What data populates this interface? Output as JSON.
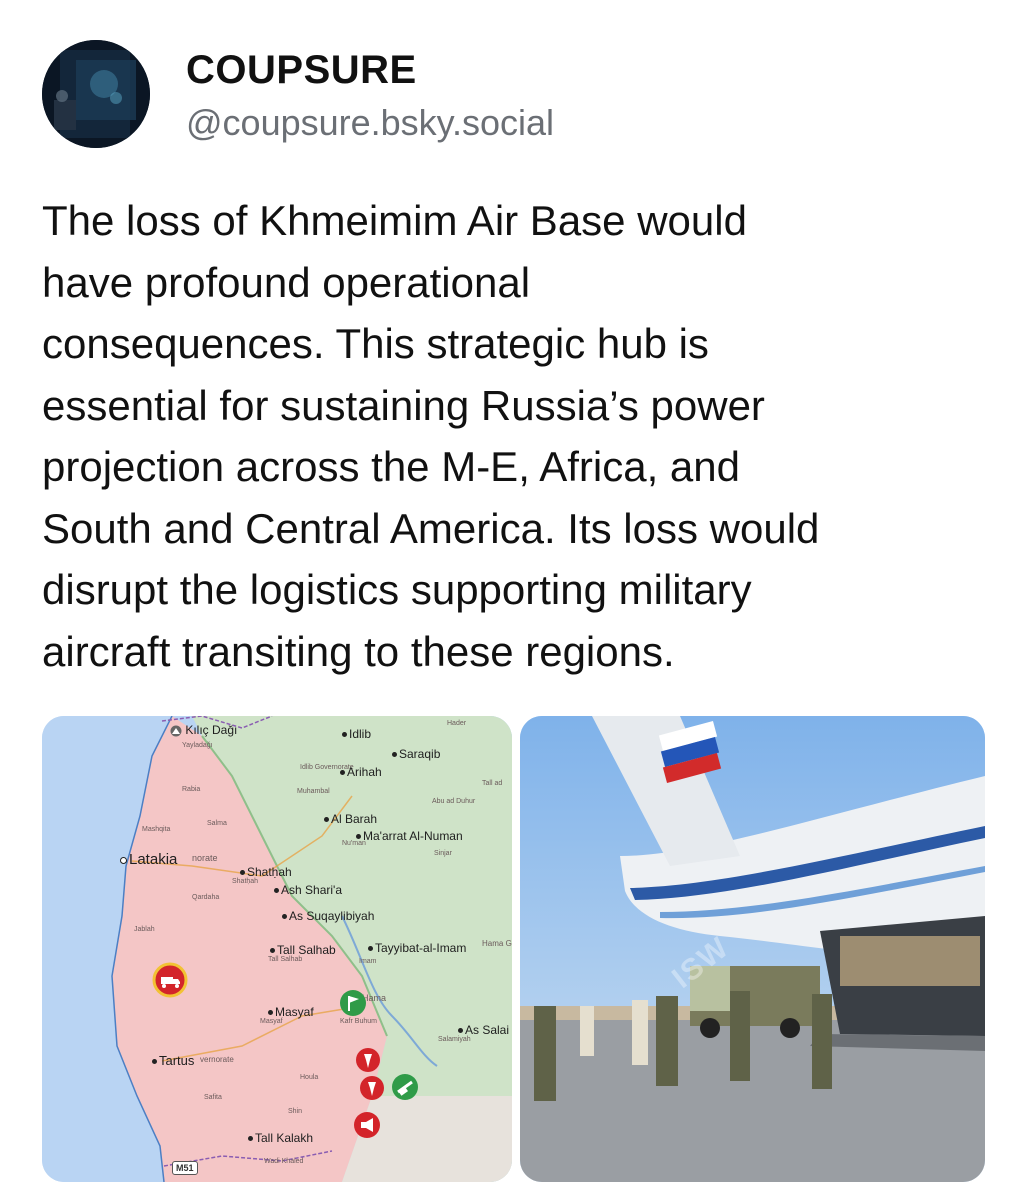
{
  "post": {
    "author_name": "COUPSURE",
    "author_handle": "@coupsure.bsky.social",
    "text": "The loss of Khmeimim Air Base would\nhave profound operational\nconsequences. This strategic hub is\nessential for sustaining Russia’s power\nprojection across the M-E, Africa, and\nSouth and Central America. Its loss would\ndisrupt the logistics supporting military\naircraft transiting to these regions."
  },
  "map": {
    "labels": {
      "kilic_dagi": "Kılıç Dağı",
      "yayladagi": "Yayladağı",
      "idlib": "Idlib",
      "idlib_gov": "Idlib Governorate",
      "saraqib": "Saraqib",
      "arihah": "Arihah",
      "rabia": "Rabia",
      "muhambal": "Muhambal",
      "hader": "Hader",
      "tall_ad": "Tall ad",
      "abu_ad_duhur": "Abu ad Duhur",
      "slinfah": "Salma",
      "mashqita": "Mashqita",
      "al_barah": "Al Barah",
      "maarrat": "Ma'arrat Al-Numan",
      "numan": "Nu'man",
      "sinjar": "Sinjar",
      "latakia": "Latakia",
      "latakia_gov": "norate",
      "qardaha": "Qardaha",
      "shathah": "Shatḥah",
      "shathah_small": "Shatḥah",
      "ash_sharia": "Ash Shari'a",
      "as_suqaylibiyah": "As Suqaylibiyah",
      "jablah": "Jablah",
      "tall_salhab": "Tall Salhab",
      "tall_salhab_small": "Tall Salhab",
      "tayyibat": "Tayyibat-al-Imam",
      "imam": "Imam",
      "hama_gov": "Hama G",
      "hama": "Hama",
      "masyaf": "Masyaf",
      "masyaf_small": "Masyaf",
      "kafr_buhum": "Kafr Buhum",
      "as_salamiyah": "As Salai",
      "salamiyah": "Salamiyah",
      "tartus": "Tartus",
      "tartus_gov": "vernorate",
      "houla": "Houla",
      "safita": "Safita",
      "shin": "Shin",
      "tall_kalakh": "Tall Kalakh",
      "wadi_khaled": "Wadi Khaled",
      "m51": "M51"
    }
  },
  "photo": {
    "watermark": "ISW"
  },
  "colors": {
    "handle_gray": "#6b6f75",
    "regime_red": "#f4c6c6",
    "opposition_green": "#cfe3c8",
    "sea_blue": "#b9d4f3",
    "marker_red": "#d3242a",
    "marker_green": "#2f9b48"
  },
  "icons": [
    "avatar-image",
    "mountain-icon",
    "truck-marker-icon",
    "flag-marker-icon",
    "clash-marker-icon",
    "tank-marker-icon",
    "megaphone-marker-icon"
  ]
}
